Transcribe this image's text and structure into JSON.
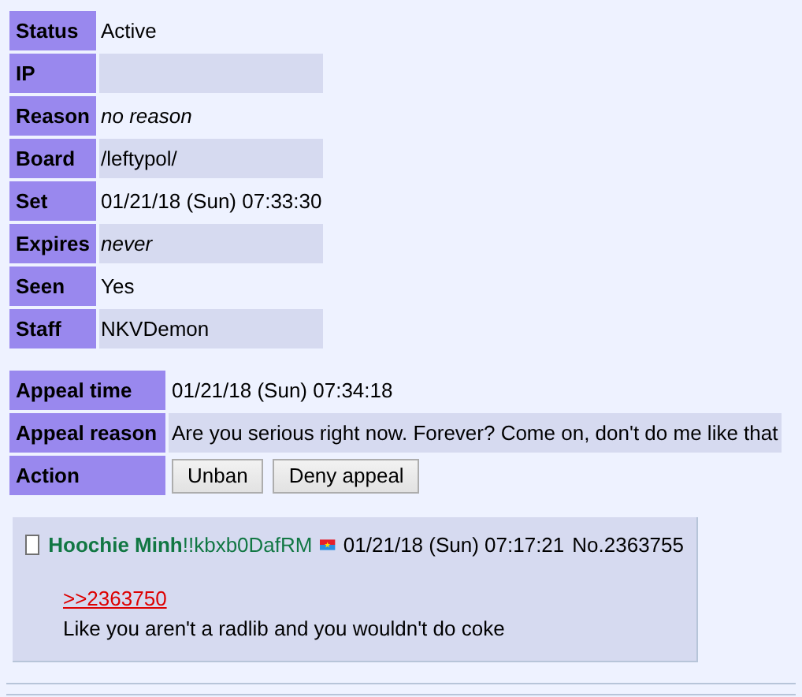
{
  "ban_details": [
    {
      "label": "Status",
      "value": "Active",
      "italic": false
    },
    {
      "label": "IP"
    },
    {
      "label": "Reason",
      "value": "no reason",
      "italic": true
    },
    {
      "label": "Board",
      "value": "/leftypol/",
      "italic": false
    },
    {
      "label": "Set",
      "value": "01/21/18 (Sun) 07:33:30",
      "italic": false
    },
    {
      "label": "Expires",
      "value": "never",
      "italic": true
    },
    {
      "label": "Seen",
      "value": "Yes",
      "italic": false
    },
    {
      "label": "Staff",
      "value": "NKVDemon",
      "italic": false
    }
  ],
  "appeal": {
    "time_label": "Appeal time",
    "time": "01/21/18 (Sun) 07:34:18",
    "reason_label": "Appeal reason",
    "reason": "Are you serious right now. Forever? Come on, don't do me like that",
    "action_label": "Action",
    "buttons": [
      "Unban",
      "Deny appeal"
    ]
  },
  "post": {
    "checked": false,
    "name": "Hoochie Minh",
    "tripcode": "!!kbxb0DafRM",
    "date": "01/21/18 (Sun) 07:17:21",
    "number": "No.2363755",
    "quote_link": ">>2363750",
    "body": "Like you aren't a radlib and you wouldn't do coke"
  }
}
